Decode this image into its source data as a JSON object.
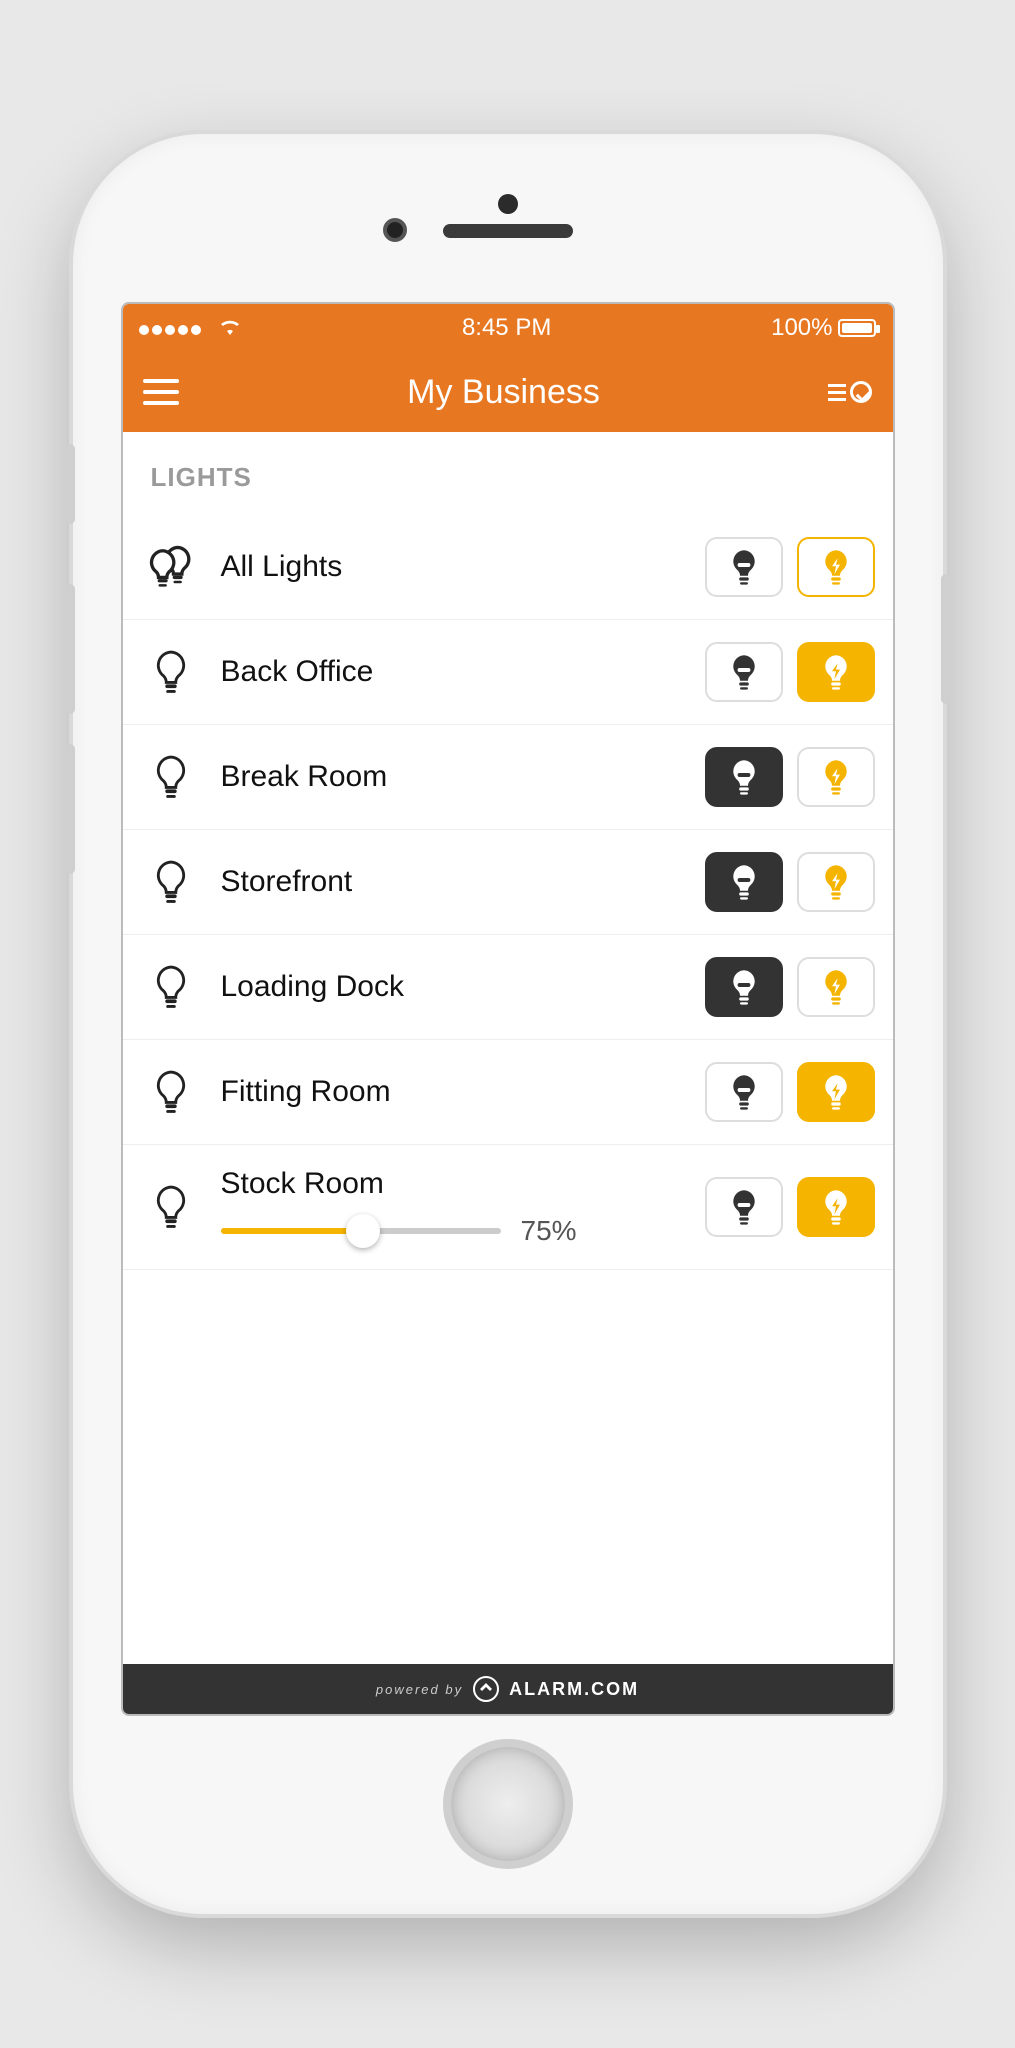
{
  "statusbar": {
    "time": "8:45 PM",
    "battery": "100%"
  },
  "navbar": {
    "title": "My Business"
  },
  "section": {
    "label": "LIGHTS"
  },
  "lights": [
    {
      "name": "All Lights",
      "icon": "double",
      "off_sel": false,
      "on_sel": false,
      "on_outline": true
    },
    {
      "name": "Back Office",
      "icon": "single",
      "off_sel": false,
      "on_sel": true
    },
    {
      "name": "Break Room",
      "icon": "single",
      "off_sel": true,
      "on_sel": false
    },
    {
      "name": "Storefront",
      "icon": "single",
      "off_sel": true,
      "on_sel": false
    },
    {
      "name": "Loading Dock",
      "icon": "single",
      "off_sel": true,
      "on_sel": false
    },
    {
      "name": "Fitting Room",
      "icon": "single",
      "off_sel": false,
      "on_sel": true
    },
    {
      "name": "Stock Room",
      "icon": "single",
      "off_sel": false,
      "on_sel": true,
      "dimmer": 75
    }
  ],
  "footer": {
    "powered": "powered by",
    "brand": "ALARM.COM"
  }
}
